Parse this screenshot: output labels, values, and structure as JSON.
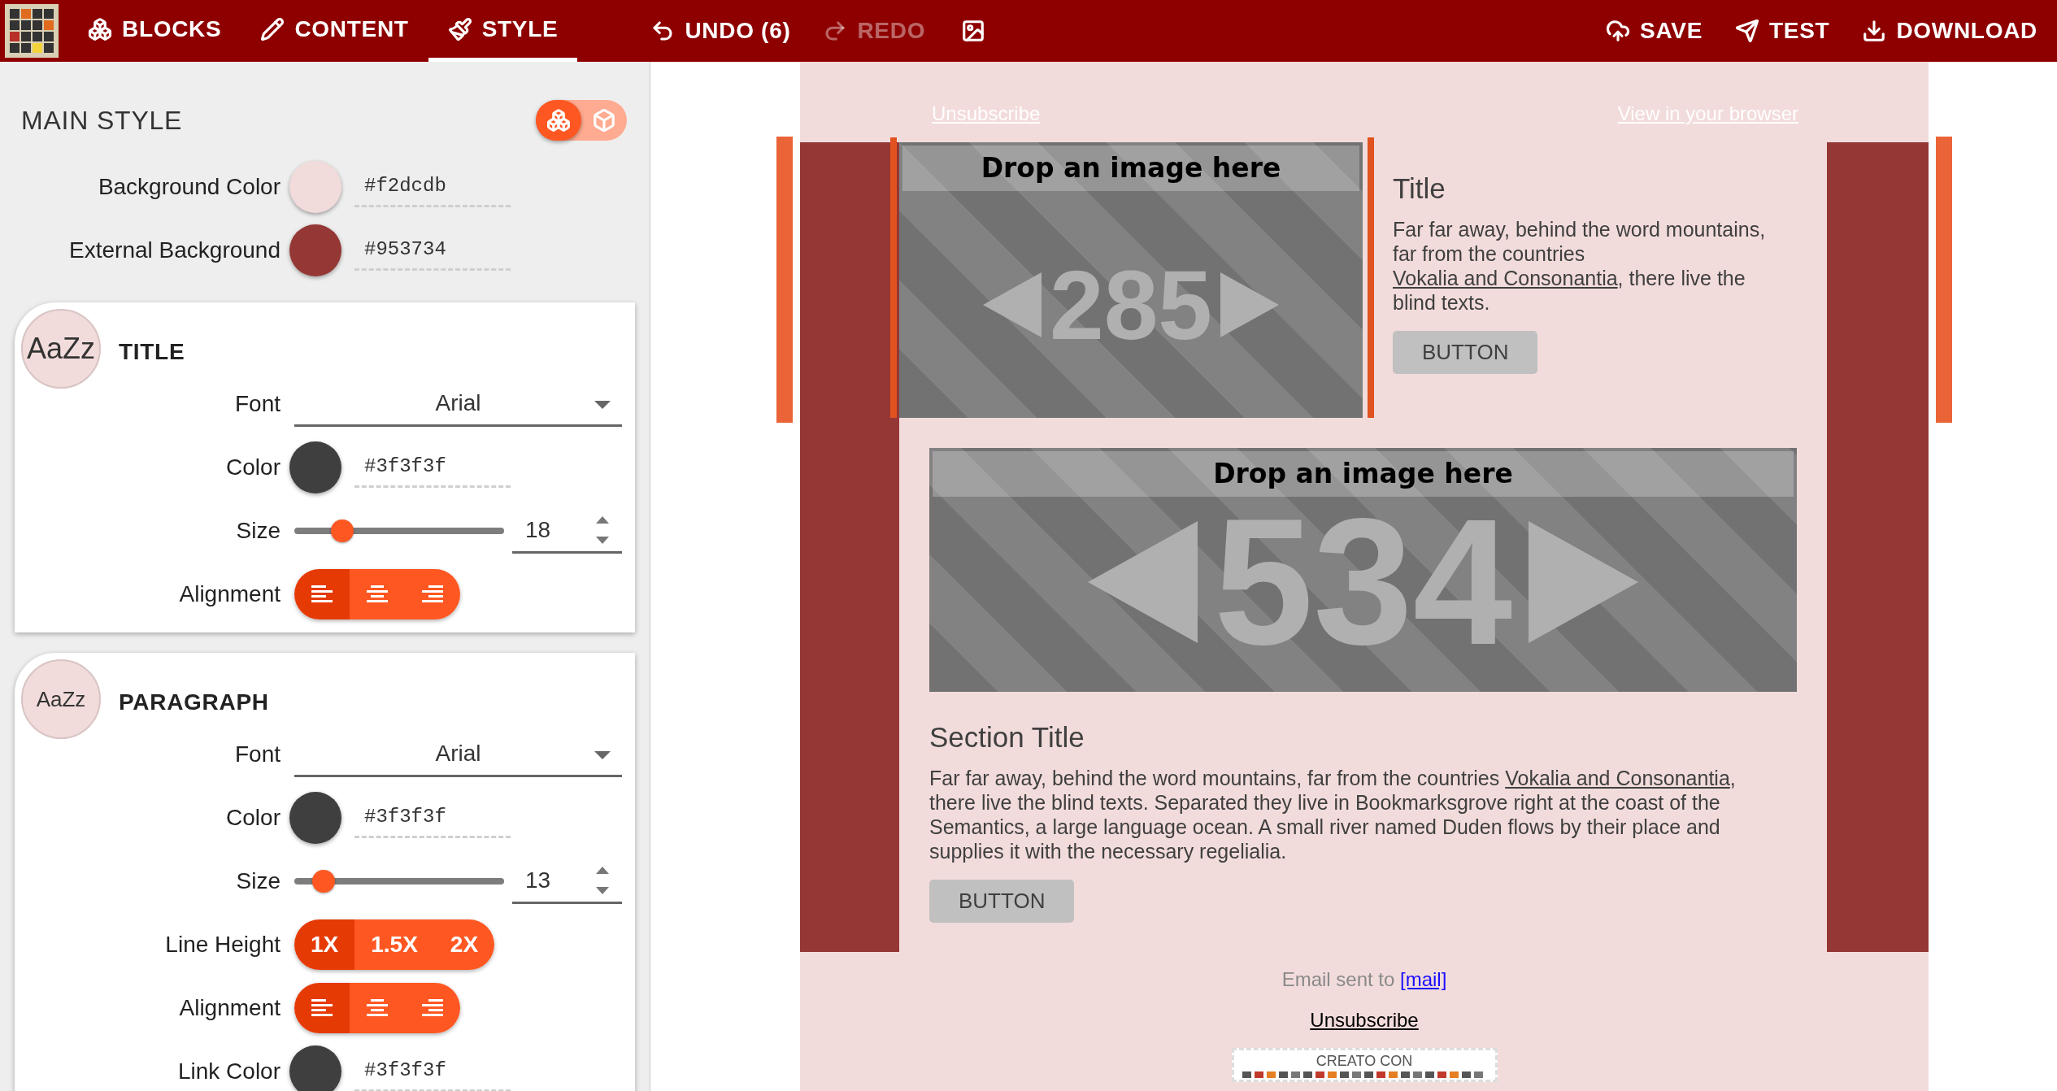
{
  "toolbar": {
    "tabs": [
      {
        "label": "BLOCKS",
        "kind": "blocks",
        "selected": false
      },
      {
        "label": "CONTENT",
        "kind": "content",
        "selected": false
      },
      {
        "label": "STYLE",
        "kind": "style",
        "selected": true
      }
    ],
    "history": [
      {
        "label": "UNDO (6)",
        "kind": "undo",
        "disabled": false
      },
      {
        "label": "REDO",
        "kind": "redo",
        "disabled": true
      }
    ],
    "actions": [
      {
        "label": "SAVE",
        "kind": "save"
      },
      {
        "label": "TEST",
        "kind": "test"
      },
      {
        "label": "DOWNLOAD",
        "kind": "download"
      }
    ]
  },
  "main_style": {
    "title": "MAIN STYLE",
    "view_toggle": [
      {
        "kind": "blocks",
        "selected": true
      },
      {
        "kind": "block",
        "selected": false
      }
    ],
    "colors": [
      {
        "label": "Background Color",
        "color": "#f2dcdb",
        "value": "#f2dcdb"
      },
      {
        "label": "External Background",
        "color": "#953734",
        "value": "#953734"
      }
    ]
  },
  "sections": [
    {
      "title": "TITLE",
      "preview": "AaZz",
      "rows": [
        {
          "kind": "font",
          "label": "Font",
          "value": "Arial"
        },
        {
          "kind": "color",
          "label": "Color",
          "color": "#3f3f3f",
          "value": "#3f3f3f"
        },
        {
          "kind": "size",
          "label": "Size",
          "value": "18",
          "level": 0.23
        },
        {
          "kind": "segments",
          "label": "Alignment",
          "options": [
            {
              "kind": "left",
              "selected": true
            },
            {
              "kind": "center",
              "selected": false
            },
            {
              "kind": "right",
              "selected": false
            }
          ]
        }
      ]
    },
    {
      "title": "PARAGRAPH",
      "preview": "AaZz",
      "rows": [
        {
          "kind": "font",
          "label": "Font",
          "value": "Arial"
        },
        {
          "kind": "color",
          "label": "Color",
          "color": "#3f3f3f",
          "value": "#3f3f3f"
        },
        {
          "kind": "size",
          "label": "Size",
          "value": "13",
          "level": 0.14
        },
        {
          "kind": "segments",
          "label": "Line Height",
          "options": [
            {
              "kind": "text",
              "label": "1X",
              "selected": true
            },
            {
              "kind": "text",
              "label": "1.5X",
              "selected": false
            },
            {
              "kind": "text",
              "label": "2X",
              "selected": false
            }
          ]
        },
        {
          "kind": "segments",
          "label": "Alignment",
          "options": [
            {
              "kind": "left",
              "selected": true
            },
            {
              "kind": "center",
              "selected": false
            },
            {
              "kind": "right",
              "selected": false
            }
          ]
        },
        {
          "kind": "color",
          "label": "Link Color",
          "color": "#3f3f3f",
          "value": "#3f3f3f"
        }
      ]
    }
  ],
  "email": {
    "top_links": [
      "Unsubscribe",
      "View in your browser"
    ],
    "blocks": [
      {
        "kind": "image_text",
        "selected": true,
        "image": {
          "caption": "Drop an image here",
          "dimension": "285"
        },
        "title": "Title",
        "paragraph": {
          "before": "Far far away, behind the word mountains, far from the countries ",
          "link": "Vokalia and Consonantia",
          "after": ", there live the blind texts."
        },
        "button": "BUTTON"
      },
      {
        "kind": "image_full",
        "selected": false,
        "image": {
          "caption": "Drop an image here",
          "dimension": "534"
        },
        "title": "Section Title",
        "paragraph": {
          "before": "Far far away, behind the word mountains, far from the countries ",
          "link": "Vokalia and Consonantia",
          "after": ", there live the blind texts. Separated they live in Bookmarksgrove right at the coast of the Semantics, a large language ocean. A small river named Duden flows by their place and supplies it with the necessary regelialia."
        },
        "button": "BUTTON"
      }
    ],
    "footer": {
      "sent_to": "Email sent to",
      "mail_link": "[mail]",
      "unsubscribe": "Unsubscribe",
      "badge": "CREATO CON"
    }
  }
}
